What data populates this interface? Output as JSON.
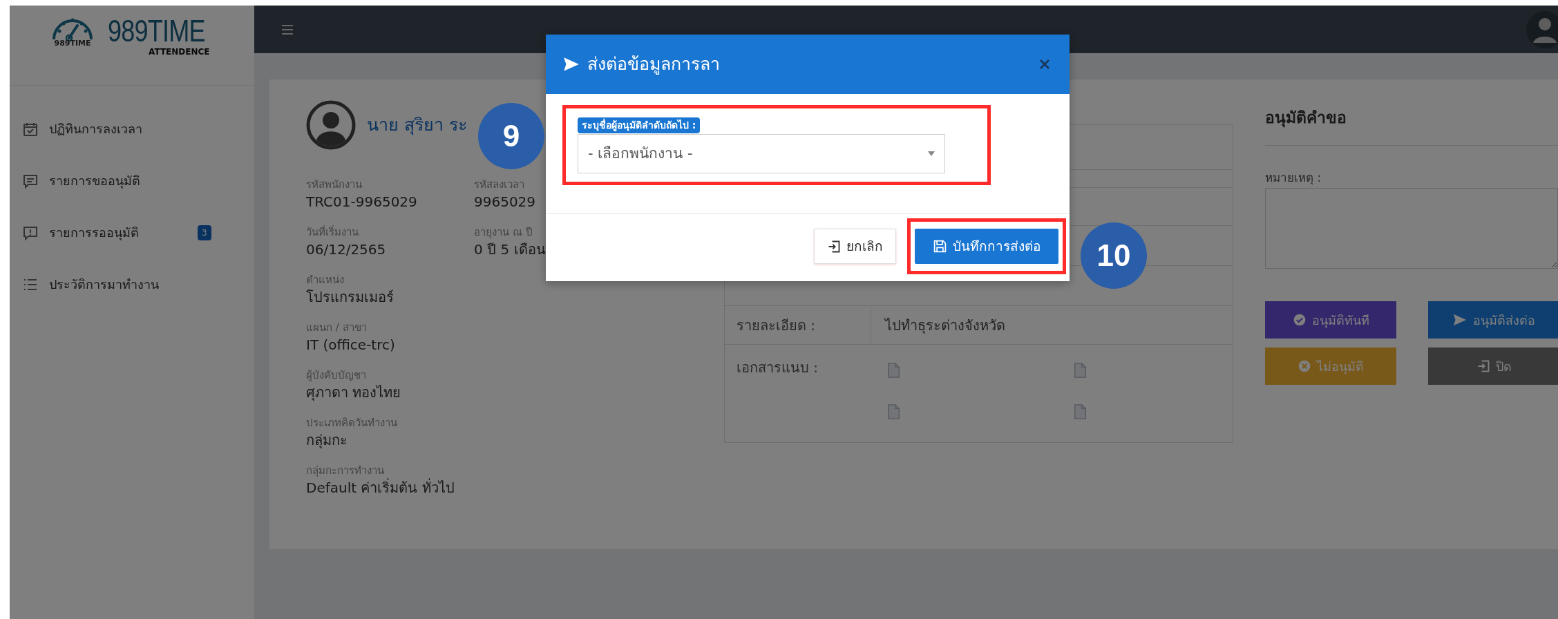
{
  "logo": {
    "icon_caption": "989TIME",
    "name": "989TIME",
    "subtitle": "ATTENDENCE"
  },
  "sidebar": {
    "items": [
      {
        "label": "ปฏิทินการลงเวลา"
      },
      {
        "label": "รายการขออนุมัติ"
      },
      {
        "label": "รายการรออนุมัติ",
        "badge": "3"
      },
      {
        "label": "ประวัติการมาทำงาน"
      }
    ]
  },
  "profile": {
    "name": "นาย สุริยา ระ",
    "field_rows": [
      [
        {
          "label": "รหัสพนักงาน",
          "value": "TRC01-9965029"
        },
        {
          "label": "รหัสลงเวลา",
          "value": "9965029"
        }
      ],
      [
        {
          "label": "วันที่เริ่มงาน",
          "value": "06/12/2565"
        },
        {
          "label": "อายุงาน ณ ปี",
          "value": "0 ปี 5 เดือน"
        }
      ],
      [
        {
          "label": "ตำแหน่ง",
          "value": "โปรแกรมเมอร์"
        }
      ],
      [
        {
          "label": "แผนก / สาขา",
          "value": "IT (office-trc)"
        }
      ],
      [
        {
          "label": "ผู้บังคับบัญชา",
          "value": "ศุภาดา ทองไทย"
        }
      ],
      [
        {
          "label": "ประเภทคิดวันทำงาน",
          "value": "กลุ่มกะ"
        }
      ],
      [
        {
          "label": "กลุ่มกะการทำงาน",
          "value": "Default ค่าเริ่มต้น ทั่วไป"
        }
      ]
    ]
  },
  "details": {
    "rows": [
      {
        "label": "รายละเอียด :",
        "value": "ไปทำธุระต่างจังหวัด"
      }
    ],
    "attachments_label": "เอกสารแนบ :",
    "attachments": [
      {
        "kind": "file"
      },
      {
        "kind": "file"
      },
      {
        "kind": "file"
      },
      {
        "kind": "file"
      }
    ]
  },
  "approval": {
    "title": "อนุมัติคำขอ",
    "remark_label": "หมายเหตุ :",
    "buttons": [
      {
        "label": "อนุมัติทันที",
        "kind": "approve"
      },
      {
        "label": "อนุมัติส่งต่อ",
        "kind": "forward"
      },
      {
        "label": "ไม่อนุมัติ",
        "kind": "reject"
      },
      {
        "label": "ปิด",
        "kind": "close"
      }
    ]
  },
  "modal": {
    "title": "ส่งต่อข้อมูลการลา",
    "field": {
      "label": "ระบุชื่อผู้อนุมัติลำดับถัดไป :",
      "placeholder": "- เลือกพนักงาน -",
      "highlighted": true
    },
    "buttons": [
      {
        "label": "ยกเลิก",
        "kind": "cancel",
        "highlighted": false
      },
      {
        "label": "บันทึกการส่งต่อ",
        "kind": "save",
        "highlighted": true
      }
    ]
  },
  "annotations": [
    {
      "number": "9"
    },
    {
      "number": "10"
    }
  ]
}
